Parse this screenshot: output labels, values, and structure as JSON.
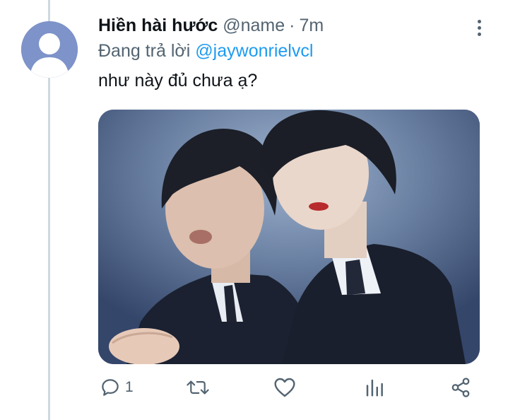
{
  "tweet": {
    "display_name": "Hiền hài hước",
    "handle": "@name",
    "separator": "·",
    "time": "7m",
    "reply_prefix": "Đang trả lời",
    "reply_mention": "@jaywonrielvcl",
    "text": "như này đủ chưa ạ?",
    "media": {
      "description_icon": "photo-two-men-in-suits"
    }
  },
  "actions": {
    "reply": {
      "icon": "reply-icon",
      "count": "1"
    },
    "retweet": {
      "icon": "retweet-icon"
    },
    "like": {
      "icon": "heart-icon"
    },
    "analytics": {
      "icon": "analytics-icon"
    },
    "share": {
      "icon": "share-icon"
    }
  },
  "colors": {
    "link": "#1d9bf0",
    "secondary_text": "#536471",
    "primary_text": "#0f1419",
    "avatar_bg": "#7d93c9",
    "thread_line": "#cfd9de"
  }
}
